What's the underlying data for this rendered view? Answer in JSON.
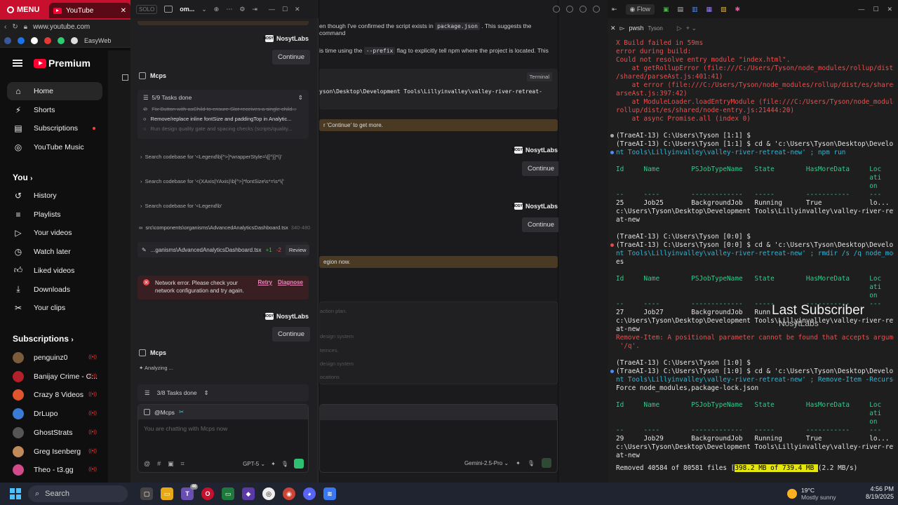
{
  "browser": {
    "menu_label": "MENU",
    "tab_label": "YouTube",
    "url": "www.youtube.com",
    "bookmark_label": "EasyWeb",
    "logo_text": "Premium"
  },
  "youtube": {
    "main_nav": [
      {
        "label": "Home",
        "icon": "home-icon"
      },
      {
        "label": "Shorts",
        "icon": "shorts-icon"
      },
      {
        "label": "Subscriptions",
        "icon": "subscriptions-icon"
      },
      {
        "label": "YouTube Music",
        "icon": "music-icon"
      }
    ],
    "you_title": "You",
    "you_nav": [
      {
        "label": "History"
      },
      {
        "label": "Playlists"
      },
      {
        "label": "Your videos"
      },
      {
        "label": "Watch later"
      },
      {
        "label": "Liked videos"
      },
      {
        "label": "Downloads"
      },
      {
        "label": "Your clips"
      }
    ],
    "subs_title": "Subscriptions",
    "subs": [
      {
        "name": "penguinz0",
        "color": "#7a5b3a"
      },
      {
        "name": "Banijay Crime - C...",
        "color": "#b3202a"
      },
      {
        "name": "Crazy 8 Videos",
        "color": "#e0552b"
      },
      {
        "name": "DrLupo",
        "color": "#3a7bd5"
      },
      {
        "name": "GhostStrats",
        "color": "#555555"
      },
      {
        "name": "Greg Isenberg",
        "color": "#c08a5a"
      },
      {
        "name": "Theo - t3.gg",
        "color": "#d24a8a"
      }
    ]
  },
  "chat": {
    "title_tab": "om...",
    "solo_label": "SOLO",
    "author": "NosytLabs",
    "logo_text": "NOSYT",
    "continue_label": "Continue",
    "agent_name": "Mcps",
    "tasks_progress": "5/9 Tasks done",
    "tasks": [
      "Fix Button with asChild to ensure Slot receives a single child...",
      "Remove/replace inline fontSize and paddingTop in Analytic...",
      "Run design quality gate and spacing checks (scripts/quality..."
    ],
    "searches": [
      "Search codebase for '<Legend\\b[^>]*wrapperStyle=\\{[^}]*\\}'",
      "Search codebase for '<(XAxis|YAxis)\\b[^>]*fontSize\\s*=\\s*\\{'",
      "Search codebase for '<Legend\\b'"
    ],
    "file_path": "src\\components\\organisms\\AdvancedAnalyticsDashboard.tsx",
    "file_range": "340-480",
    "diff_file": "...ganisms\\AdvancedAnalyticsDashboard.tsx",
    "diff_added": "+1",
    "diff_removed": "-2",
    "review_label": "Review",
    "error_text": "Network error. Please check your network configuration and try again.",
    "retry_label": "Retry",
    "diagnose_label": "Diagnose",
    "analyzing": "Analyzing ...",
    "tasks_progress_2": "3/8 Tasks done",
    "mention": "@Mcps",
    "input_placeholder": "You are chatting with Mcps now",
    "model": "GPT-5"
  },
  "second_chat": {
    "line1_pre": "en though I've confirmed the script exists in",
    "line1_code": "package.json",
    "line1_post": ". This suggests the command",
    "line2_pre": "is time using the",
    "line2_code": "--prefix",
    "line2_post": "flag to explicitly tell npm where the project is located. This",
    "terminal_label": "Terminal",
    "terminal_cmd": "yson\\Desktop\\Development Tools\\Lillyinvalley\\valley-river-retreat-",
    "note1": "r 'Continue' to get more.",
    "author": "NosytLabs",
    "logo_text": "NOSYT",
    "continue_label": "Continue",
    "note2": "egion now.",
    "faded": [
      "action plan.",
      "design system",
      "ternces.",
      "design system",
      "ocations"
    ],
    "model": "Gemini-2.5-Pro"
  },
  "terminal": {
    "flow_label": "Flow",
    "shell_label": "pwsh",
    "shell_user": "Tyson",
    "lines": [
      {
        "t": "X Build failed in 59ms",
        "c": "t-red"
      },
      {
        "t": "error during build:",
        "c": "t-red"
      },
      {
        "t": "Could not resolve entry module \"index.html\".",
        "c": "t-red"
      },
      {
        "t": "    at getRollupError (file:///C:/Users/Tyson/node_modules/rollup/dist/es",
        "c": "t-red"
      },
      {
        "t": "/shared/parseAst.js:401:41)",
        "c": "t-red"
      },
      {
        "t": "    at error (file:///C:/Users/Tyson/node_modules/rollup/dist/es/shared/p",
        "c": "t-red"
      },
      {
        "t": "arseAst.js:397:42)",
        "c": "t-red"
      },
      {
        "t": "    at ModuleLoader.loadEntryModule (file:///C:/Users/Tyson/node_modules/",
        "c": "t-red"
      },
      {
        "t": "rollup/dist/es/shared/node-entry.js:21444:20)",
        "c": "t-red"
      },
      {
        "t": "    at async Promise.all (index 0)",
        "c": "t-red"
      },
      {
        "t": "",
        "c": ""
      },
      {
        "t": "(TraeAI-13) C:\\Users\\Tyson [1:1] $",
        "c": "t-white"
      },
      {
        "t": "(TraeAI-13) C:\\Users\\Tyson [1:1] $ cd & 'c:\\Users\\Tyson\\Desktop\\Developme",
        "c": "t-white"
      },
      {
        "t": "nt Tools\\Lillyinvalley\\valley-river-retreat-new' ; npm run",
        "c": "t-cyan"
      },
      {
        "t": "",
        "c": ""
      },
      {
        "t": "Id     Name        PSJobTypeName   State        HasMoreData     Loc",
        "c": "t-green"
      },
      {
        "t": "                                                                ati",
        "c": "t-green"
      },
      {
        "t": "                                                                on",
        "c": "t-green"
      },
      {
        "t": "--     ----        -------------   -----        -----------     ---",
        "c": "t-green"
      },
      {
        "t": "25     Job25       BackgroundJob   Running      True            lo...",
        "c": "t-white"
      },
      {
        "t": "c:\\Users\\Tyson\\Desktop\\Development Tools\\Lillyinvalley\\valley-river-retre",
        "c": "t-white"
      },
      {
        "t": "at-new",
        "c": "t-white"
      },
      {
        "t": "",
        "c": ""
      },
      {
        "t": "(TraeAI-13) C:\\Users\\Tyson [0:0] $",
        "c": "t-white"
      },
      {
        "t": "(TraeAI-13) C:\\Users\\Tyson [0:0] $ cd & 'c:\\Users\\Tyson\\Desktop\\Developme",
        "c": "t-white"
      },
      {
        "t": "nt Tools\\Lillyinvalley\\valley-river-retreat-new' ; rmdir /s /q node_modul",
        "c": "t-cyan"
      },
      {
        "t": "es",
        "c": "t-white"
      },
      {
        "t": "",
        "c": ""
      },
      {
        "t": "Id     Name        PSJobTypeName   State        HasMoreData     Loc",
        "c": "t-green"
      },
      {
        "t": "                                                                ati",
        "c": "t-green"
      },
      {
        "t": "                                                                on",
        "c": "t-green"
      },
      {
        "t": "--     ----        -------------   -----        -----------     ---",
        "c": "t-green"
      },
      {
        "t": "27     Job27       BackgroundJob   Runn",
        "c": "t-white"
      },
      {
        "t": "c:\\Users\\Tyson\\Desktop\\Development Tools\\Lillyinvalley\\valley-river-retre",
        "c": "t-white"
      },
      {
        "t": "at-new",
        "c": "t-white"
      },
      {
        "t": "Remove-Item: A positional parameter cannot be found that accepts argument",
        "c": "t-red"
      },
      {
        "t": " '/q'.",
        "c": "t-red"
      },
      {
        "t": "",
        "c": ""
      },
      {
        "t": "(TraeAI-13) C:\\Users\\Tyson [1:0] $",
        "c": "t-white"
      },
      {
        "t": "(TraeAI-13) C:\\Users\\Tyson [1:0] $ cd & 'c:\\Users\\Tyson\\Desktop\\Developme",
        "c": "t-white"
      },
      {
        "t": "nt Tools\\Lillyinvalley\\valley-river-retreat-new' ; Remove-Item -Recurse -",
        "c": "t-cyan"
      },
      {
        "t": "Force node_modules,package-lock.json",
        "c": "t-white"
      },
      {
        "t": "",
        "c": ""
      },
      {
        "t": "Id     Name        PSJobTypeName   State        HasMoreData     Loc",
        "c": "t-green"
      },
      {
        "t": "                                                                ati",
        "c": "t-green"
      },
      {
        "t": "                                                                on",
        "c": "t-green"
      },
      {
        "t": "--     ----        -------------   -----        -----------     ---",
        "c": "t-green"
      },
      {
        "t": "29     Job29       BackgroundJob   Running      True            lo...",
        "c": "t-white"
      },
      {
        "t": "c:\\Users\\Tyson\\Desktop\\Development Tools\\Lillyinvalley\\valley-river-retre",
        "c": "t-white"
      },
      {
        "t": "at-new",
        "c": "t-white"
      }
    ],
    "progress_pre": "Removed 40584 of 80581 files [",
    "progress_hl": "398.2 MB of 739.4 MB ",
    "progress_post": "(2.2 MB/s)          ]",
    "overlay_title": "Last Subscriber",
    "overlay_name": "NosytLabs"
  },
  "taskbar": {
    "search_label": "Search",
    "badge": "46",
    "temp": "19°C",
    "weather": "Mostly sunny",
    "time": "4:56 PM",
    "date": "8/19/2025"
  }
}
